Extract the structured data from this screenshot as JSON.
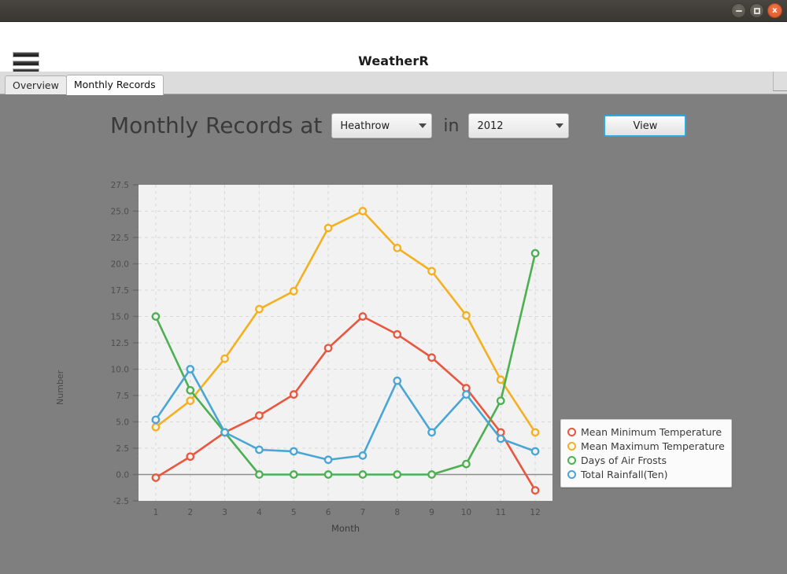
{
  "window": {
    "minimize_label": "–",
    "maximize_label": "□",
    "close_label": "x"
  },
  "header": {
    "title": "WeatherR",
    "menu_icon": "hamburger-icon"
  },
  "tabs": [
    {
      "label": "Overview",
      "active": false
    },
    {
      "label": "Monthly Records",
      "active": true
    }
  ],
  "controls": {
    "headline": "Monthly Records at",
    "station_select": {
      "value": "Heathrow"
    },
    "conjunction": "in",
    "year_select": {
      "value": "2012"
    },
    "view_button": "View"
  },
  "chart_data": {
    "type": "line",
    "title": "",
    "xlabel": "Month",
    "ylabel": "Number",
    "x": [
      1,
      2,
      3,
      4,
      5,
      6,
      7,
      8,
      9,
      10,
      11,
      12
    ],
    "xticks": [
      "1",
      "2",
      "3",
      "4",
      "5",
      "6",
      "7",
      "8",
      "9",
      "10",
      "11",
      "12"
    ],
    "yticks": [
      "-2.5",
      "0.0",
      "2.5",
      "5.0",
      "7.5",
      "10.0",
      "12.5",
      "15.0",
      "17.5",
      "20.0",
      "22.5",
      "25.0",
      "27.5"
    ],
    "ylim": [
      -2.5,
      27.5
    ],
    "xlim": [
      0.5,
      12.5
    ],
    "grid": true,
    "legend_position": "right",
    "plot_bg": "#f2f2f2",
    "series": [
      {
        "name": "Mean Minimum Temperature",
        "color": "#e8573f",
        "values": [
          -0.3,
          1.7,
          4.0,
          5.6,
          7.6,
          12.0,
          15.0,
          13.3,
          11.1,
          8.2,
          4.0,
          -1.5
        ]
      },
      {
        "name": "Mean Maximum Temperature",
        "color": "#f5b01f",
        "values": [
          4.5,
          7.0,
          11.0,
          15.7,
          17.4,
          23.4,
          25.0,
          21.5,
          19.3,
          15.1,
          9.0,
          4.0
        ]
      },
      {
        "name": "Days of Air Frosts",
        "color": "#4caf50",
        "values": [
          15.0,
          8.0,
          4.0,
          0.0,
          0.0,
          0.0,
          0.0,
          0.0,
          0.0,
          1.0,
          7.0,
          21.0
        ]
      },
      {
        "name": "Total Rainfall(Ten)",
        "color": "#49a6d4",
        "values": [
          5.2,
          10.0,
          4.0,
          2.35,
          2.2,
          1.4,
          1.8,
          8.9,
          4.0,
          7.6,
          3.4,
          2.2
        ]
      }
    ]
  }
}
